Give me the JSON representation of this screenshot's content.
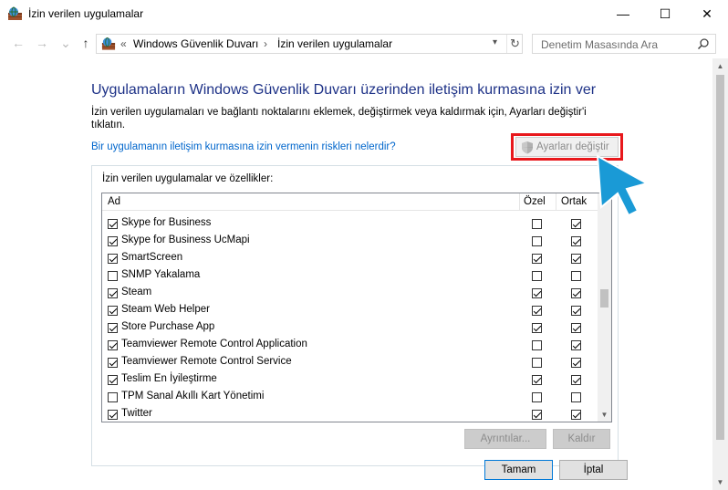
{
  "window": {
    "title": "İzin verilen uygulamalar",
    "minimize": "—",
    "maximize": "☐",
    "close": "✕"
  },
  "address": {
    "overflow": "«",
    "crumbs": [
      "Windows Güvenlik Duvarı",
      "İzin verilen uygulamalar"
    ],
    "separator": "›",
    "dropdown": "▾",
    "refresh": "↻",
    "search_placeholder": "Denetim Masasında Ara"
  },
  "nav": {
    "back": "←",
    "forward": "→",
    "recent": "⌄",
    "up": "↑"
  },
  "main": {
    "heading": "Uygulamaların Windows Güvenlik Duvarı üzerinden iletişim kurmasına izin ver",
    "description": "İzin verilen uygulamaları ve bağlantı noktalarını eklemek, değiştirmek veya kaldırmak için, Ayarları değiştir'i tıklatın.",
    "risk_link": "Bir uygulamanın iletişim kurmasına izin vermenin riskleri nelerdir?",
    "change_settings": "Ayarları değiştir"
  },
  "apps": {
    "group_label": "İzin verilen uygulamalar ve özellikler:",
    "col_name": "Ad",
    "col_private": "Özel",
    "col_public": "Ortak",
    "rows": [
      {
        "name": "Skype for Business",
        "enabled": true,
        "private": false,
        "public": true
      },
      {
        "name": "Skype for Business UcMapi",
        "enabled": true,
        "private": false,
        "public": true
      },
      {
        "name": "SmartScreen",
        "enabled": true,
        "private": true,
        "public": true
      },
      {
        "name": "SNMP Yakalama",
        "enabled": false,
        "private": false,
        "public": false
      },
      {
        "name": "Steam",
        "enabled": true,
        "private": true,
        "public": true
      },
      {
        "name": "Steam Web Helper",
        "enabled": true,
        "private": true,
        "public": true
      },
      {
        "name": "Store Purchase App",
        "enabled": true,
        "private": true,
        "public": true
      },
      {
        "name": "Teamviewer Remote Control Application",
        "enabled": true,
        "private": false,
        "public": true
      },
      {
        "name": "Teamviewer Remote Control Service",
        "enabled": true,
        "private": false,
        "public": true
      },
      {
        "name": "Teslim En İyileştirme",
        "enabled": true,
        "private": true,
        "public": true
      },
      {
        "name": "TPM Sanal Akıllı Kart Yönetimi",
        "enabled": false,
        "private": false,
        "public": false
      },
      {
        "name": "Twitter",
        "enabled": true,
        "private": true,
        "public": true
      }
    ],
    "details_button": "Ayrıntılar...",
    "remove_button": "Kaldır"
  },
  "footer": {
    "ok": "Tamam",
    "cancel": "İptal"
  },
  "colors": {
    "heading": "#1e3287",
    "link": "#0066cc",
    "highlight": "#e8181c",
    "cursor": "#1a9ad6"
  }
}
